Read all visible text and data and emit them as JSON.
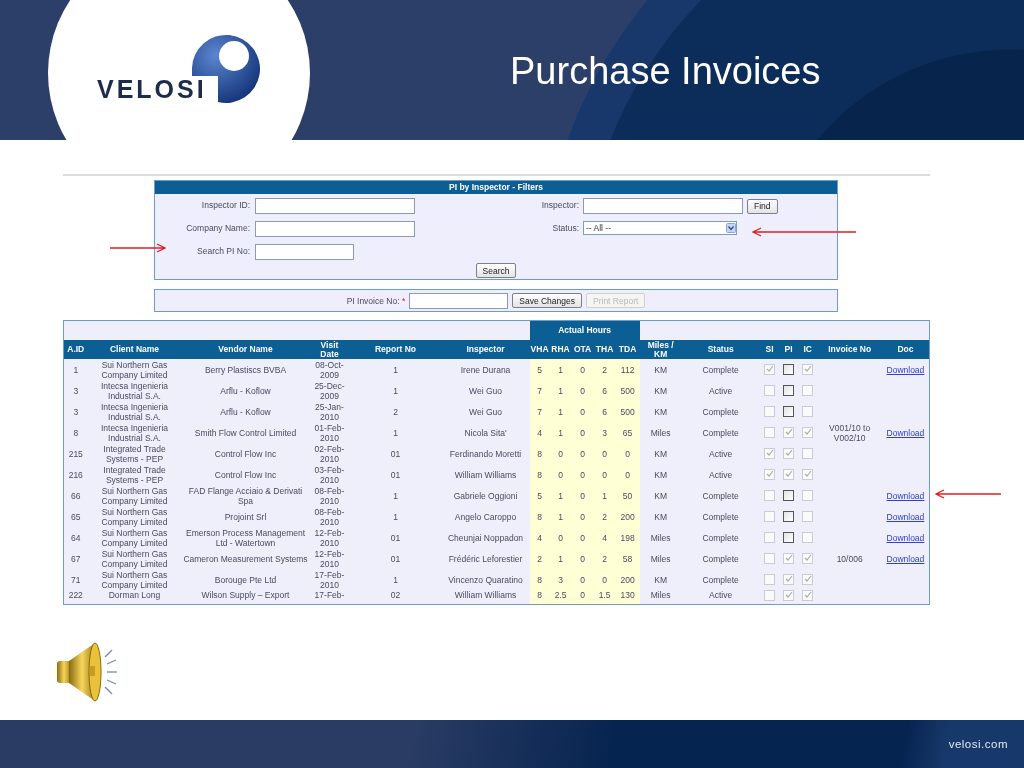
{
  "slide": {
    "logo_text": "VELOSI",
    "title": "Purchase Invoices",
    "footer": "velosi.com"
  },
  "filters": {
    "title": "PI by Inspector - Filters",
    "left_fields": [
      {
        "label": "Inspector ID:",
        "kind": "text"
      },
      {
        "label": "Company Name:",
        "kind": "text"
      },
      {
        "label": "Search PI No:",
        "kind": "short"
      }
    ],
    "right_fields": [
      {
        "label": "Inspector:",
        "kind": "text",
        "button": "Find"
      },
      {
        "label": "Status:",
        "kind": "select",
        "value": "-- All --"
      }
    ],
    "search_button": "Search"
  },
  "invoice_bar": {
    "label": "PI Invoice No:",
    "required_mark": "*",
    "buttons": [
      {
        "label": "Save Changes",
        "disabled": false
      },
      {
        "label": "Print Report",
        "disabled": true
      }
    ]
  },
  "table": {
    "group_header": "Actual Hours",
    "columns": [
      "A.ID",
      "Client Name",
      "Vendor Name",
      "Visit Date",
      "Report No",
      "Inspector",
      "VHA",
      "RHA",
      "OTA",
      "THA",
      "TDA",
      "Miles / KM",
      "Status",
      "SI",
      "PI",
      "IC",
      "Invoice No",
      "Doc"
    ],
    "rows": [
      {
        "cells": [
          "1",
          "Sui Northern Gas Company Limited",
          "Berry Plastiscs BVBA",
          "08-Oct-2009",
          "1",
          "Irene Durana",
          "5",
          "1",
          "0",
          "2",
          "112",
          "KM",
          "Complete"
        ],
        "checks": [
          {
            "checked": true,
            "disabled": true
          },
          {
            "checked": false,
            "disabled": false
          },
          {
            "checked": true,
            "disabled": true
          }
        ],
        "doc": "Download"
      },
      {
        "cells": [
          "3",
          "Intecsa Ingenieria Industrial S.A.",
          "Arflu - Koflow",
          "25-Dec-2009",
          "1",
          "Wei Guo",
          "7",
          "1",
          "0",
          "6",
          "500",
          "KM",
          "Active"
        ],
        "checks": [
          {
            "checked": false,
            "disabled": true
          },
          {
            "checked": false,
            "disabled": false
          },
          {
            "checked": false,
            "disabled": true
          }
        ]
      },
      {
        "cells": [
          "3",
          "Intecsa Ingenieria Industrial S.A.",
          "Arflu - Koflow",
          "25-Jan-2010",
          "2",
          "Wei Guo",
          "7",
          "1",
          "0",
          "6",
          "500",
          "KM",
          "Complete"
        ],
        "checks": [
          {
            "checked": false,
            "disabled": true
          },
          {
            "checked": false,
            "disabled": false
          },
          {
            "checked": false,
            "disabled": true
          }
        ]
      },
      {
        "cells": [
          "8",
          "Intecsa Ingenieria Industrial S.A.",
          "Smith Flow Control Limited",
          "01-Feb-2010",
          "1",
          "Nicola Sita'",
          "4",
          "1",
          "0",
          "3",
          "65",
          "Miles",
          "Complete"
        ],
        "checks": [
          {
            "checked": false,
            "disabled": true
          },
          {
            "checked": true,
            "disabled": true
          },
          {
            "checked": true,
            "disabled": true
          }
        ],
        "invoice_no": "V001/10 to V002/10",
        "doc": "Download"
      },
      {
        "cells": [
          "215",
          "Integrated Trade Systems - PEP",
          "Control Flow Inc",
          "02-Feb-2010",
          "01",
          "Ferdinando Moretti",
          "8",
          "0",
          "0",
          "0",
          "0",
          "KM",
          "Active"
        ],
        "checks": [
          {
            "checked": true,
            "disabled": true
          },
          {
            "checked": true,
            "disabled": true
          },
          {
            "checked": false,
            "disabled": true
          }
        ]
      },
      {
        "cells": [
          "216",
          "Integrated Trade Systems - PEP",
          "Control Flow Inc",
          "03-Feb-2010",
          "01",
          "William Williams",
          "8",
          "0",
          "0",
          "0",
          "0",
          "KM",
          "Active"
        ],
        "checks": [
          {
            "checked": true,
            "disabled": true
          },
          {
            "checked": true,
            "disabled": true
          },
          {
            "checked": true,
            "disabled": true
          }
        ]
      },
      {
        "cells": [
          "66",
          "Sui Northern Gas Company Limited",
          "FAD Flange Acciaio & Derivati Spa",
          "08-Feb-2010",
          "1",
          "Gabriele Oggioni",
          "5",
          "1",
          "0",
          "1",
          "50",
          "KM",
          "Complete"
        ],
        "checks": [
          {
            "checked": false,
            "disabled": true
          },
          {
            "checked": false,
            "disabled": false
          },
          {
            "checked": false,
            "disabled": true
          }
        ],
        "doc": "Download"
      },
      {
        "cells": [
          "65",
          "Sui Northern Gas Company Limited",
          "Projoint Srl",
          "08-Feb-2010",
          "1",
          "Angelo Caroppo",
          "8",
          "1",
          "0",
          "2",
          "200",
          "KM",
          "Complete"
        ],
        "checks": [
          {
            "checked": false,
            "disabled": true
          },
          {
            "checked": false,
            "disabled": false
          },
          {
            "checked": false,
            "disabled": true
          }
        ],
        "doc": "Download"
      },
      {
        "cells": [
          "64",
          "Sui Northern Gas Company Limited",
          "Emerson Process Management Ltd - Watertown",
          "12-Feb-2010",
          "01",
          "Cheunjai Noppadon",
          "4",
          "0",
          "0",
          "4",
          "198",
          "Miles",
          "Complete"
        ],
        "checks": [
          {
            "checked": false,
            "disabled": true
          },
          {
            "checked": false,
            "disabled": false
          },
          {
            "checked": false,
            "disabled": true
          }
        ],
        "doc": "Download"
      },
      {
        "cells": [
          "67",
          "Sui Northern Gas Company Limited",
          "Cameron Measurement Systems",
          "12-Feb-2010",
          "01",
          "Frédéric Leforestier",
          "2",
          "1",
          "0",
          "2",
          "58",
          "Miles",
          "Complete"
        ],
        "checks": [
          {
            "checked": false,
            "disabled": true
          },
          {
            "checked": true,
            "disabled": true
          },
          {
            "checked": true,
            "disabled": true
          }
        ],
        "invoice_no": "10/006",
        "doc": "Download"
      },
      {
        "cells": [
          "71",
          "Sui Northern Gas Company Limited",
          "Borouge Pte Ltd",
          "17-Feb-2010",
          "1",
          "Vincenzo Quaratino",
          "8",
          "3",
          "0",
          "0",
          "200",
          "KM",
          "Complete"
        ],
        "checks": [
          {
            "checked": false,
            "disabled": true
          },
          {
            "checked": true,
            "disabled": true
          },
          {
            "checked": true,
            "disabled": true
          }
        ]
      },
      {
        "cells": [
          "222",
          "Dorman Long",
          "Wilson Supply – Export",
          "17-Feb-",
          "02",
          "William Williams",
          "8",
          "2.5",
          "0",
          "1.5",
          "130",
          "Miles",
          "Active"
        ],
        "checks": [
          {
            "checked": false,
            "disabled": true
          },
          {
            "checked": true,
            "disabled": true
          },
          {
            "checked": true,
            "disabled": true
          }
        ]
      }
    ]
  }
}
